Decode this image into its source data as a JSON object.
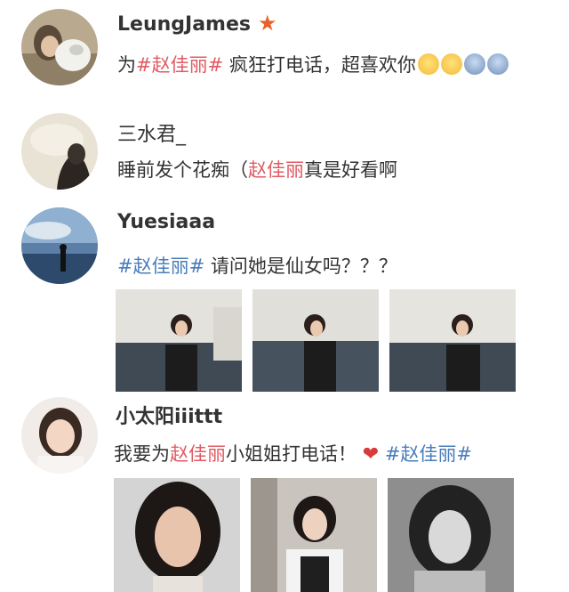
{
  "posts": [
    {
      "user": "LeungJames",
      "content": [
        "为",
        "#赵佳丽#",
        " 疯狂打电话，超喜欢你"
      ],
      "has_star": true,
      "emoji_icons": [
        "face-kiss-heart-icon",
        "face-kiss-heart-icon",
        "scream-face-icon",
        "scream-face-icon"
      ]
    },
    {
      "user": "三水君_",
      "content": [
        "睡前发个花痴（",
        "赵佳丽",
        "真是好看啊"
      ]
    },
    {
      "user": "Yuesiaaa",
      "content": [
        "#赵佳丽#",
        " 请问她是仙女吗？？？"
      ]
    },
    {
      "user": "小太阳iiittt",
      "content": [
        "我要为",
        "赵佳丽",
        "小姐姐打电话！",
        "#赵佳丽#"
      ],
      "icon": "heart-icon"
    }
  ],
  "colors": {
    "hashtag": "#4a7dbb",
    "name": "#e15b64",
    "star": "#e8632b"
  }
}
